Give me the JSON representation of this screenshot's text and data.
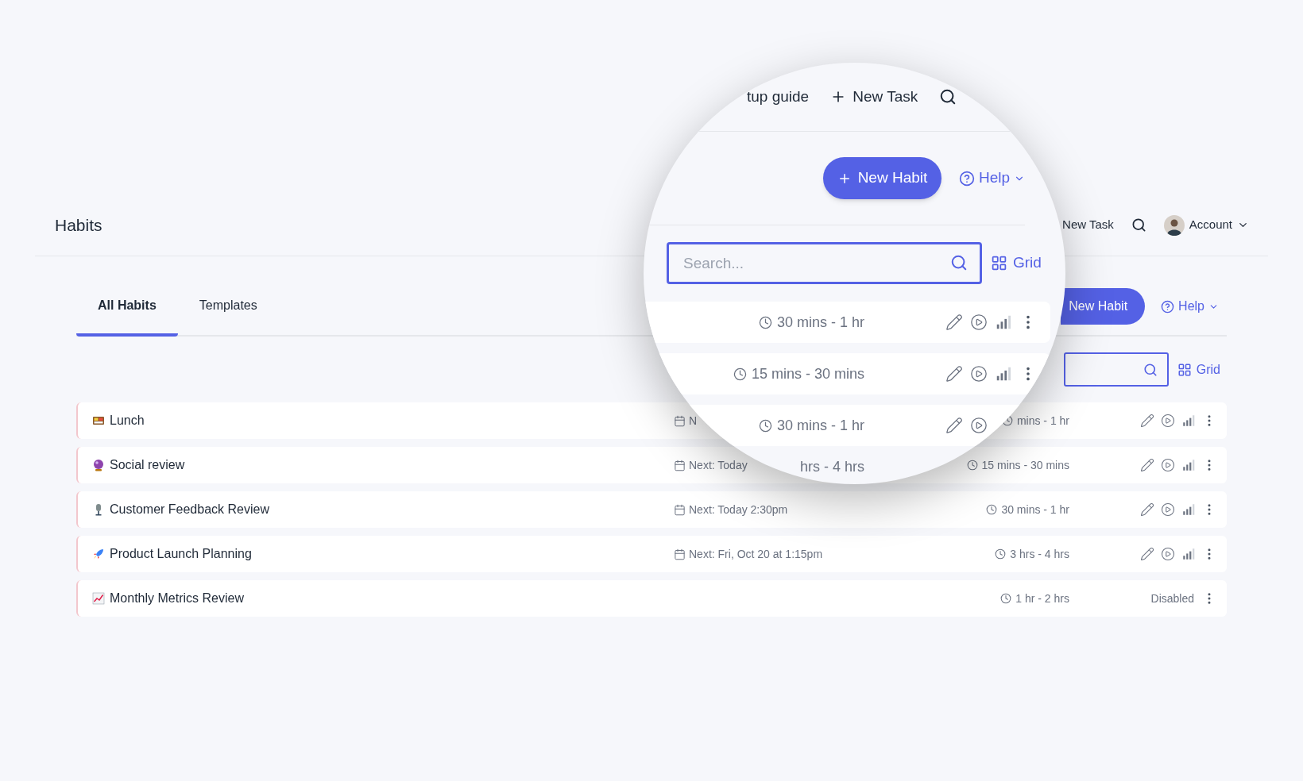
{
  "page_title": "Habits",
  "header": {
    "new_task": "New Task",
    "account": "Account"
  },
  "tabs": [
    {
      "label": "All Habits",
      "selected": true
    },
    {
      "label": "Templates",
      "selected": false
    }
  ],
  "new_habit": "New Habit",
  "help": "Help",
  "grid": "Grid",
  "habits": [
    {
      "kind": "active",
      "name": "Lunch",
      "next": "N",
      "duration": "mins - 1 hr"
    },
    {
      "kind": "active",
      "name": "Social review",
      "next": "Next: Today",
      "duration": "15 mins - 30 mins"
    },
    {
      "kind": "active",
      "name": "Customer Feedback Review",
      "next": "Next: Today 2:30pm",
      "duration": "30 mins - 1 hr"
    },
    {
      "kind": "active",
      "name": "Product Launch Planning",
      "next": "Next: Fri, Oct 20 at 1:15pm",
      "duration": "3 hrs - 4 hrs"
    },
    {
      "kind": "disabled",
      "name": "Monthly Metrics Review",
      "duration": "1 hr - 2 hrs",
      "status": "Disabled"
    }
  ],
  "magnifier": {
    "setup_guide": "tup guide",
    "new_task": "New Task",
    "new_habit": "New Habit",
    "help": "Help",
    "search_placeholder": "Search...",
    "grid": "Grid",
    "rows": [
      {
        "kind": "full",
        "duration": "30 mins - 1 hr"
      },
      {
        "kind": "full",
        "duration": "15 mins - 30 mins"
      },
      {
        "kind": "partial",
        "duration": "30 mins - 1 hr"
      },
      {
        "kind": "text_only",
        "duration": "hrs - 4 hrs"
      }
    ]
  }
}
